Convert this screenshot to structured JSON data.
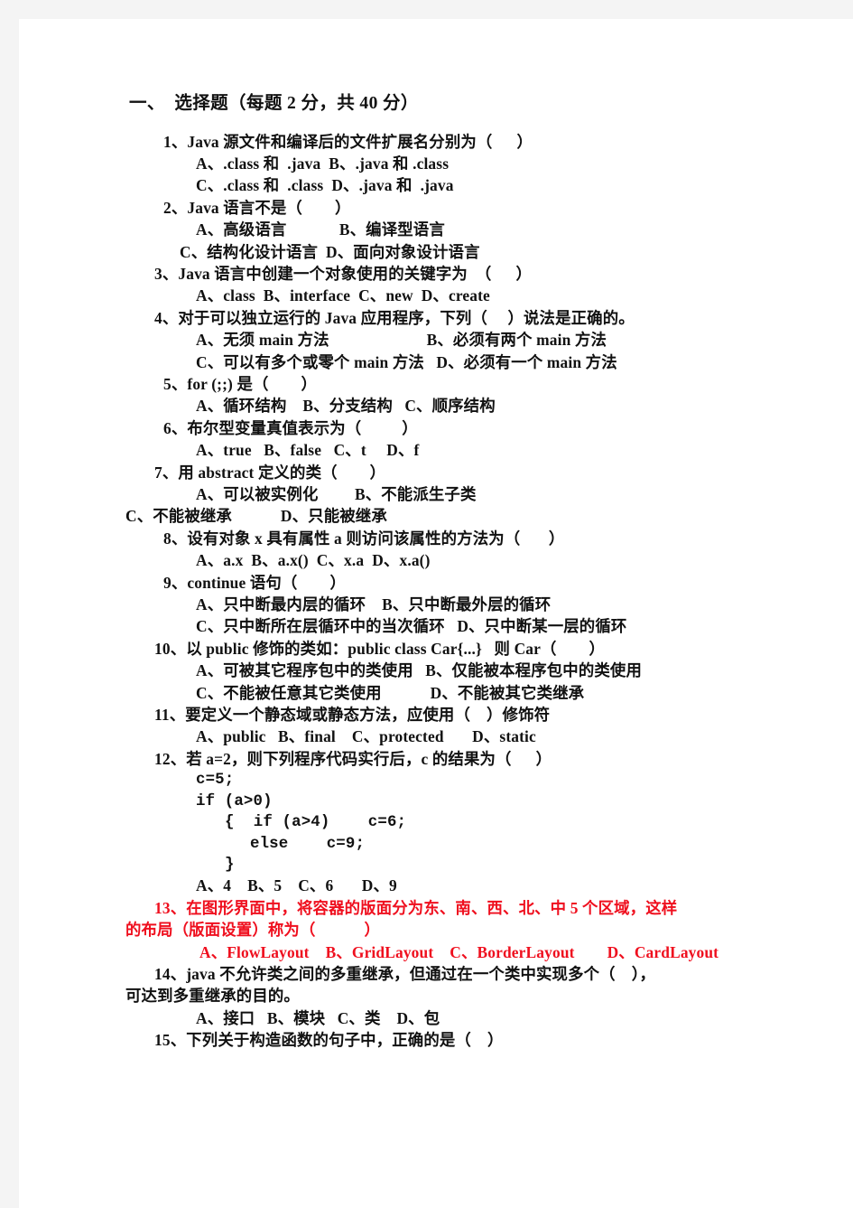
{
  "page": {
    "background_color": "#f4f4f4",
    "paper_color": "#ffffff",
    "text_color": "#111111",
    "highlight_color": "#ef0f1e"
  },
  "heading": {
    "text": "一、  选择题（每题 2 分，共 40 分）"
  },
  "questions": [
    {
      "number": "1",
      "stem": "1、Java 源文件和编译后的文件扩展名分别为（      ）",
      "options": [
        "A、.class 和  .java  B、.java 和 .class",
        "C、.class 和  .class  D、.java 和  .java"
      ],
      "color": "black"
    },
    {
      "number": "2",
      "stem": "2、Java 语言不是（        ）",
      "options": [
        "A、高级语言             B、编译型语言",
        "C、结构化设计语言  D、面向对象设计语言"
      ],
      "color": "black"
    },
    {
      "number": "3",
      "stem": "3、Java 语言中创建一个对象使用的关键字为  （      ）",
      "options": [
        "A、class  B、interface  C、new  D、create"
      ],
      "color": "black"
    },
    {
      "number": "4",
      "stem": "4、对于可以独立运行的 Java 应用程序，下列（     ）说法是正确的。",
      "options": [
        "A、无须 main 方法                        B、必须有两个 main 方法",
        "C、可以有多个或零个 main 方法   D、必须有一个 main 方法"
      ],
      "color": "black"
    },
    {
      "number": "5",
      "stem": "5、for (;;) 是（        ）",
      "options": [
        "A、循环结构    B、分支结构   C、顺序结构"
      ],
      "color": "black"
    },
    {
      "number": "6",
      "stem": "6、布尔型变量真值表示为（          ）",
      "options": [
        "A、true   B、false   C、t     D、f"
      ],
      "color": "black"
    },
    {
      "number": "7",
      "stem": "7、用 abstract 定义的类（        ）",
      "options": [
        "A、可以被实例化         B、不能派生子类",
        "C、不能被继承            D、只能被继承"
      ],
      "color": "black"
    },
    {
      "number": "8",
      "stem": "8、设有对象 x 具有属性 a 则访问该属性的方法为（       ）",
      "options": [
        "A、a.x  B、a.x()  C、x.a  D、x.a()"
      ],
      "color": "black"
    },
    {
      "number": "9",
      "stem": "9、continue 语句（        ）",
      "options": [
        "A、只中断最内层的循环    B、只中断最外层的循环",
        "C、只中断所在层循环中的当次循环   D、只中断某一层的循环"
      ],
      "color": "black"
    },
    {
      "number": "10",
      "stem": "10、以 public 修饰的类如：public class Car{...}   则 Car（        ）",
      "options": [
        "A、可被其它程序包中的类使用   B、仅能被本程序包中的类使用",
        "C、不能被任意其它类使用            D、不能被其它类继承"
      ],
      "color": "black"
    },
    {
      "number": "11",
      "stem": "11、要定义一个静态域或静态方法，应使用（    ）修饰符",
      "options": [
        "A、public   B、final    C、protected       D、static"
      ],
      "color": "black"
    },
    {
      "number": "12",
      "stem": "12、若 a=2，则下列程序代码实行后，c 的结果为（      ）",
      "code": [
        "c=5;",
        "if (a>0)",
        "{  if (a>4)    c=6;",
        "else    c=9;",
        "}"
      ],
      "options": [
        "A、4    B、5    C、6       D、9"
      ],
      "color": "black"
    },
    {
      "number": "13",
      "stem_lines": [
        "13、在图形界面中，将容器的版面分为东、南、西、北、中 5 个区域，这样",
        "的布局（版面设置）称为（            ）"
      ],
      "options": [
        "A、FlowLayout    B、GridLayout    C、BorderLayout        D、CardLayout"
      ],
      "color": "red"
    },
    {
      "number": "14",
      "stem_lines": [
        "14、java 不允许类之间的多重继承，但通过在一个类中实现多个（    ），",
        "可达到多重继承的目的。"
      ],
      "options": [
        "A、接口   B、模块   C、类    D、包"
      ],
      "color": "black"
    },
    {
      "number": "15",
      "stem": "15、下列关于构造函数的句子中，正确的是（    ）",
      "options": [],
      "color": "black"
    }
  ]
}
